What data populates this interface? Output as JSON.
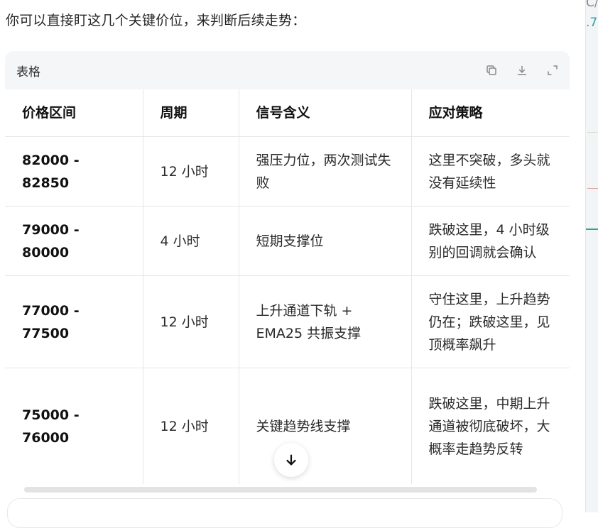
{
  "intro_text": "你可以直接盯这几个关键价位，来判断后续走势：",
  "card": {
    "title": "表格",
    "actions": [
      {
        "name": "copy-icon"
      },
      {
        "name": "download-icon"
      },
      {
        "name": "expand-icon"
      }
    ]
  },
  "table": {
    "headers": [
      "价格区间",
      "周期",
      "信号含义",
      "应对策略"
    ],
    "rows": [
      {
        "price": "82000 - 82850",
        "period": "12 小时",
        "signal": "强压力位，两次测试失败",
        "strategy": "这里不突破，多头就没有延续性"
      },
      {
        "price": "79000 - 80000",
        "period": "4 小时",
        "signal": "短期支撑位",
        "strategy": "跌破这里，4 小时级别的回调就会确认"
      },
      {
        "price": "77000 - 77500",
        "period": "12 小时",
        "signal": "上升通道下轨 + EMA25 共振支撑",
        "strategy": "守住这里，上升趋势仍在；跌破这里，见顶概率飙升"
      },
      {
        "price": "75000 - 76000",
        "period": "12 小时",
        "signal": "关键趋势线支撑",
        "strategy": "跌破这里，中期上升通道被彻底破坏，大概率走趋势反转"
      }
    ]
  },
  "side": {
    "text1": "C/U",
    "text2": ".7"
  },
  "colors": {
    "accent_green": "#26a69a",
    "card_bg": "#f5f6f7"
  }
}
